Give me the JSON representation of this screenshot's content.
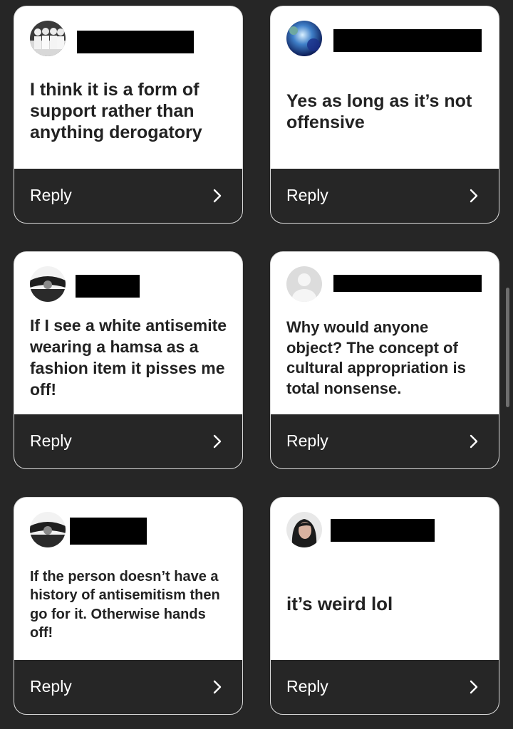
{
  "reply_label": "Reply",
  "cards": [
    {
      "message": "I think it is a form of support rather than anything derogatory"
    },
    {
      "message": "Yes as long as it’s not offensive"
    },
    {
      "message": "If I see a white antisemite wearing a hamsa as a fashion item it pisses me off!"
    },
    {
      "message": "Why would anyone object? The concept of cultural appropriation is total nonsense."
    },
    {
      "message": "If the person doesn’t have a history of antisemitism then go for it. Otherwise hands off!"
    },
    {
      "message": "it’s weird lol"
    }
  ],
  "colors": {
    "background": "#262626",
    "card": "#ffffff",
    "reply_bar": "#262626",
    "text": "#222222"
  },
  "icons": [
    "chevron-right-icon",
    "avatar-photo"
  ]
}
